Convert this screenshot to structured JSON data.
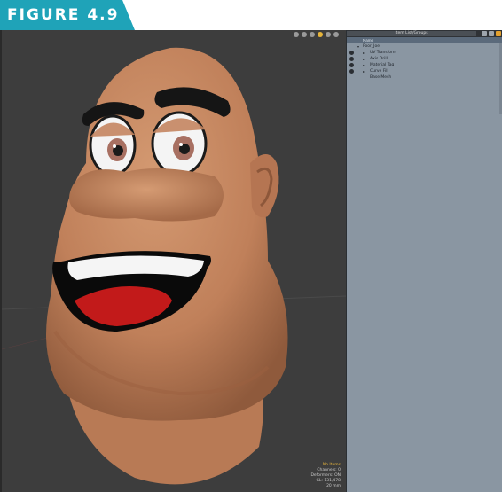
{
  "figure": {
    "label": "FIGURE 4.9",
    "accent_color": "#1fa3b8"
  },
  "viewport": {
    "hud": {
      "status": "No Items",
      "channels": "Channels: 0",
      "deformers": "Deformers: ON",
      "gl": "GL: 131,478",
      "units": "20 mm"
    },
    "colors": {
      "background": "#3d3d3d",
      "skin": "#c98a62",
      "mouth": "#0a0a0a",
      "tongue": "#c21a1a"
    }
  },
  "panel": {
    "title": "Item List/Groups",
    "column_header": "Name",
    "items": [
      {
        "label": "Poor_Joe",
        "indent": 0,
        "eye": false
      },
      {
        "label": "UV Transform",
        "indent": 1,
        "eye": true
      },
      {
        "label": "Axis Drill",
        "indent": 1,
        "eye": true
      },
      {
        "label": "Material Tag",
        "indent": 1,
        "eye": true
      },
      {
        "label": "Curve Fill",
        "indent": 1,
        "eye": true
      },
      {
        "label": "Base Mesh",
        "indent": 1,
        "eye": false
      }
    ]
  }
}
